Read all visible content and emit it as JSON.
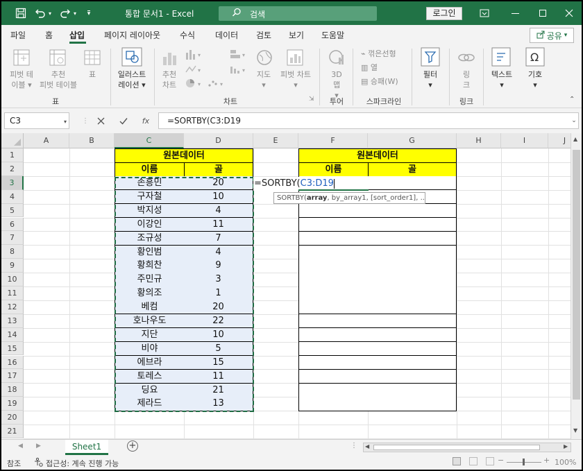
{
  "titlebar": {
    "doc_title": "통합 문서1  -  Excel",
    "search_label": "검색",
    "login_label": "로그인"
  },
  "tabs": [
    "파일",
    "홈",
    "삽입",
    "페이지 레이아웃",
    "수식",
    "데이터",
    "검토",
    "보기",
    "도움말"
  ],
  "active_tab": "삽입",
  "share_label": "공유",
  "ribbon": {
    "pivot_label_1": "피벗 테",
    "pivot_label_2": "이블",
    "rec_pivot_1": "추천",
    "rec_pivot_2": "피벗 테이블",
    "table_label": "표",
    "illust_1": "일러스트",
    "illust_2": "레이션",
    "rec_chart_1": "추천",
    "rec_chart_2": "차트",
    "map_label": "지도",
    "pivot_chart_label": "피벗 차트",
    "map3d_1": "3D",
    "map3d_2": "맵",
    "spark_line": "꺾은선형",
    "spark_col": "열",
    "spark_winloss": "승패(W)",
    "filter_label": "필터",
    "link_label": "링",
    "link_label_2": "크",
    "text_label": "텍스트",
    "symbol_label": "기호",
    "groups": {
      "table": "표",
      "chart": "차트",
      "tour": "투어",
      "sparkline": "스파크라인",
      "link": "링크"
    }
  },
  "formula_bar": {
    "name_box": "C3",
    "formula": "=SORTBY(C3:D19"
  },
  "columns": [
    "A",
    "B",
    "C",
    "D",
    "E",
    "F",
    "G",
    "H",
    "I",
    "J"
  ],
  "rows": [
    "1",
    "2",
    "3",
    "4",
    "5",
    "6",
    "7",
    "8",
    "9",
    "10",
    "11",
    "12",
    "13",
    "14",
    "15",
    "16",
    "17",
    "18",
    "19",
    "20",
    "21"
  ],
  "source_table": {
    "title": "원본데이터",
    "col_name": "이름",
    "col_value": "골",
    "data": [
      [
        "손흥민",
        "20"
      ],
      [
        "구자철",
        "10"
      ],
      [
        "박지성",
        "4"
      ],
      [
        "이강인",
        "11"
      ],
      [
        "조규성",
        "7"
      ],
      [
        "황인범",
        "4"
      ],
      [
        "황희찬",
        "9"
      ],
      [
        "주민규",
        "3"
      ],
      [
        "황의조",
        "1"
      ],
      [
        "베컴",
        "20"
      ],
      [
        "호나우도",
        "22"
      ],
      [
        "지단",
        "10"
      ],
      [
        "비야",
        "5"
      ],
      [
        "에브라",
        "15"
      ],
      [
        "토레스",
        "11"
      ],
      [
        "딩요",
        "21"
      ],
      [
        "제라드",
        "13"
      ]
    ]
  },
  "result_table": {
    "title": "원본데이터",
    "col_name": "이름",
    "col_value": "골"
  },
  "edit": {
    "prefix": "=SORTBY(",
    "ref": "C3:D19",
    "tooltip_fn": "SORTBY(",
    "tooltip_arg": "array",
    "tooltip_rest": ", by_array1, [sort_order1], ...)"
  },
  "sheet_tab": "Sheet1",
  "status": {
    "mode": "참조",
    "accessibility": "접근성: 계속 진행 가능",
    "zoom": "100%"
  },
  "colors": {
    "accent": "#217346",
    "header_yellow": "#ffff00",
    "selection_fill": "#e7eef9"
  }
}
